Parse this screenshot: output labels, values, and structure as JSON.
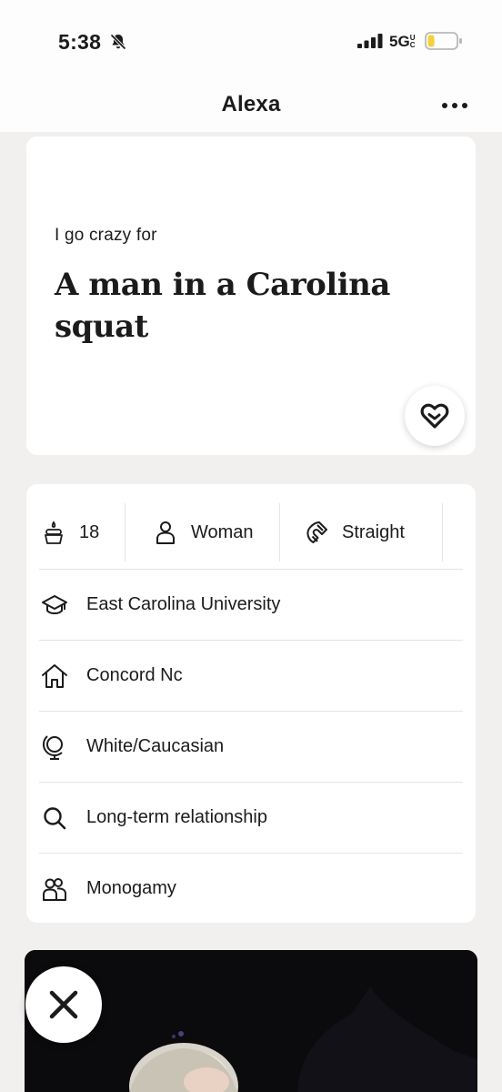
{
  "status": {
    "time": "5:38",
    "network": "5G",
    "network_suffix": "UC"
  },
  "header": {
    "title": "Alexa"
  },
  "prompt": {
    "question": "I go crazy for",
    "answer": "A man in a Carolina squat"
  },
  "vitals": {
    "age": "18",
    "gender": "Woman",
    "orientation": "Straight"
  },
  "info": {
    "school": "East Carolina University",
    "hometown": "Concord Nc",
    "ethnicity": "White/Caucasian",
    "looking_for": "Long-term relationship",
    "relationship_type": "Monogamy"
  },
  "icons": {
    "bell": "bell-slash-icon",
    "signal": "signal-bars-icon",
    "battery": "battery-low-icon",
    "more": "ellipsis-icon",
    "like": "heart-icon",
    "dismiss": "close-x-icon"
  },
  "colors": {
    "accent": "#1b1b1b",
    "battery_fill": "#f6cf3c",
    "background": "#f1f0ef"
  }
}
